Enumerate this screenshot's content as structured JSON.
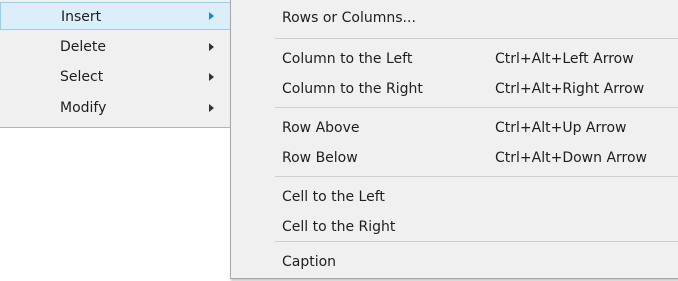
{
  "parent_menu": {
    "items": [
      {
        "label": "Insert",
        "has_submenu": true,
        "highlighted": true
      },
      {
        "label": "Delete",
        "has_submenu": true,
        "highlighted": false
      },
      {
        "label": "Select",
        "has_submenu": true,
        "highlighted": false
      },
      {
        "label": "Modify",
        "has_submenu": true,
        "highlighted": false
      }
    ]
  },
  "submenu": {
    "items": [
      {
        "label": "Rows or Columns...",
        "shortcut": ""
      },
      {
        "label": "Column to the Left",
        "shortcut": "Ctrl+Alt+Left Arrow"
      },
      {
        "label": "Column to the Right",
        "shortcut": "Ctrl+Alt+Right Arrow"
      },
      {
        "label": "Row Above",
        "shortcut": "Ctrl+Alt+Up Arrow"
      },
      {
        "label": "Row Below",
        "shortcut": "Ctrl+Alt+Down Arrow"
      },
      {
        "label": "Cell to the Left",
        "shortcut": ""
      },
      {
        "label": "Cell to the Right",
        "shortcut": ""
      },
      {
        "label": "Caption",
        "shortcut": ""
      }
    ]
  },
  "colors": {
    "menu_background": "#f0f0f0",
    "highlight_background": "#dceefa",
    "highlight_border": "#9ccbeb",
    "highlight_arrow": "#1a84e6"
  },
  "icons": {
    "submenu_arrow": "chevron-right-icon"
  }
}
